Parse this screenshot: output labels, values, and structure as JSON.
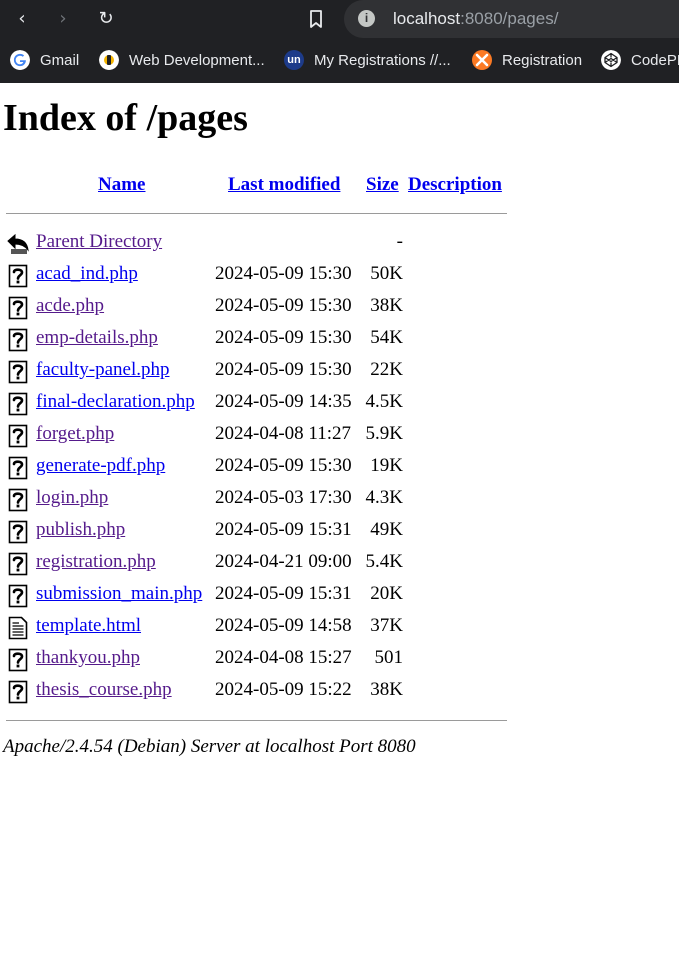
{
  "browser": {
    "url_host": "localhost",
    "url_rest": ":8080/pages/",
    "nav_back": "‹",
    "nav_forward": "›",
    "nav_reload": "↻",
    "info_icon": "i",
    "bookmarks": [
      {
        "label": "Gmail",
        "icon": "google-icon"
      },
      {
        "label": "Web Development...",
        "icon": "web-dev-icon"
      },
      {
        "label": "My Registrations //...",
        "icon": "un-icon",
        "icon_text": "un"
      },
      {
        "label": "Registration",
        "icon": "xampp-icon"
      },
      {
        "label": "CodePE",
        "icon": "codepen-icon"
      }
    ]
  },
  "page": {
    "title": "Index of /pages",
    "headers": {
      "name": "Name",
      "last_modified": "Last modified",
      "size": "Size",
      "description": "Description"
    },
    "parent": {
      "label": "Parent Directory",
      "size": "-"
    },
    "files": [
      {
        "name": "acad_ind.php",
        "modified": "2024-05-09 15:30",
        "size": "50K",
        "icon": "unknown-file-icon",
        "visited": false
      },
      {
        "name": "acde.php",
        "modified": "2024-05-09 15:30",
        "size": "38K",
        "icon": "unknown-file-icon",
        "visited": true
      },
      {
        "name": "emp-details.php",
        "modified": "2024-05-09 15:30",
        "size": "54K",
        "icon": "unknown-file-icon",
        "visited": true
      },
      {
        "name": "faculty-panel.php",
        "modified": "2024-05-09 15:30",
        "size": "22K",
        "icon": "unknown-file-icon",
        "visited": false
      },
      {
        "name": "final-declaration.php",
        "modified": "2024-05-09 14:35",
        "size": "4.5K",
        "icon": "unknown-file-icon",
        "visited": false
      },
      {
        "name": "forget.php",
        "modified": "2024-04-08 11:27",
        "size": "5.9K",
        "icon": "unknown-file-icon",
        "visited": true
      },
      {
        "name": "generate-pdf.php",
        "modified": "2024-05-09 15:30",
        "size": "19K",
        "icon": "unknown-file-icon",
        "visited": false
      },
      {
        "name": "login.php",
        "modified": "2024-05-03 17:30",
        "size": "4.3K",
        "icon": "unknown-file-icon",
        "visited": true
      },
      {
        "name": "publish.php",
        "modified": "2024-05-09 15:31",
        "size": "49K",
        "icon": "unknown-file-icon",
        "visited": true
      },
      {
        "name": "registration.php",
        "modified": "2024-04-21 09:00",
        "size": "5.4K",
        "icon": "unknown-file-icon",
        "visited": true
      },
      {
        "name": "submission_main.php",
        "modified": "2024-05-09 15:31",
        "size": "20K",
        "icon": "unknown-file-icon",
        "visited": false
      },
      {
        "name": "template.html",
        "modified": "2024-05-09 14:58",
        "size": "37K",
        "icon": "text-file-icon",
        "visited": false
      },
      {
        "name": "thankyou.php",
        "modified": "2024-04-08 15:27",
        "size": "501",
        "icon": "unknown-file-icon",
        "visited": true
      },
      {
        "name": "thesis_course.php",
        "modified": "2024-05-09 15:22",
        "size": "38K",
        "icon": "unknown-file-icon",
        "visited": true
      }
    ],
    "footer": "Apache/2.4.54 (Debian) Server at localhost Port 8080"
  },
  "colors": {
    "link": "#0000ee",
    "visited": "#551a8b",
    "chrome_bg": "#202124",
    "omnibox_bg": "#303134"
  }
}
